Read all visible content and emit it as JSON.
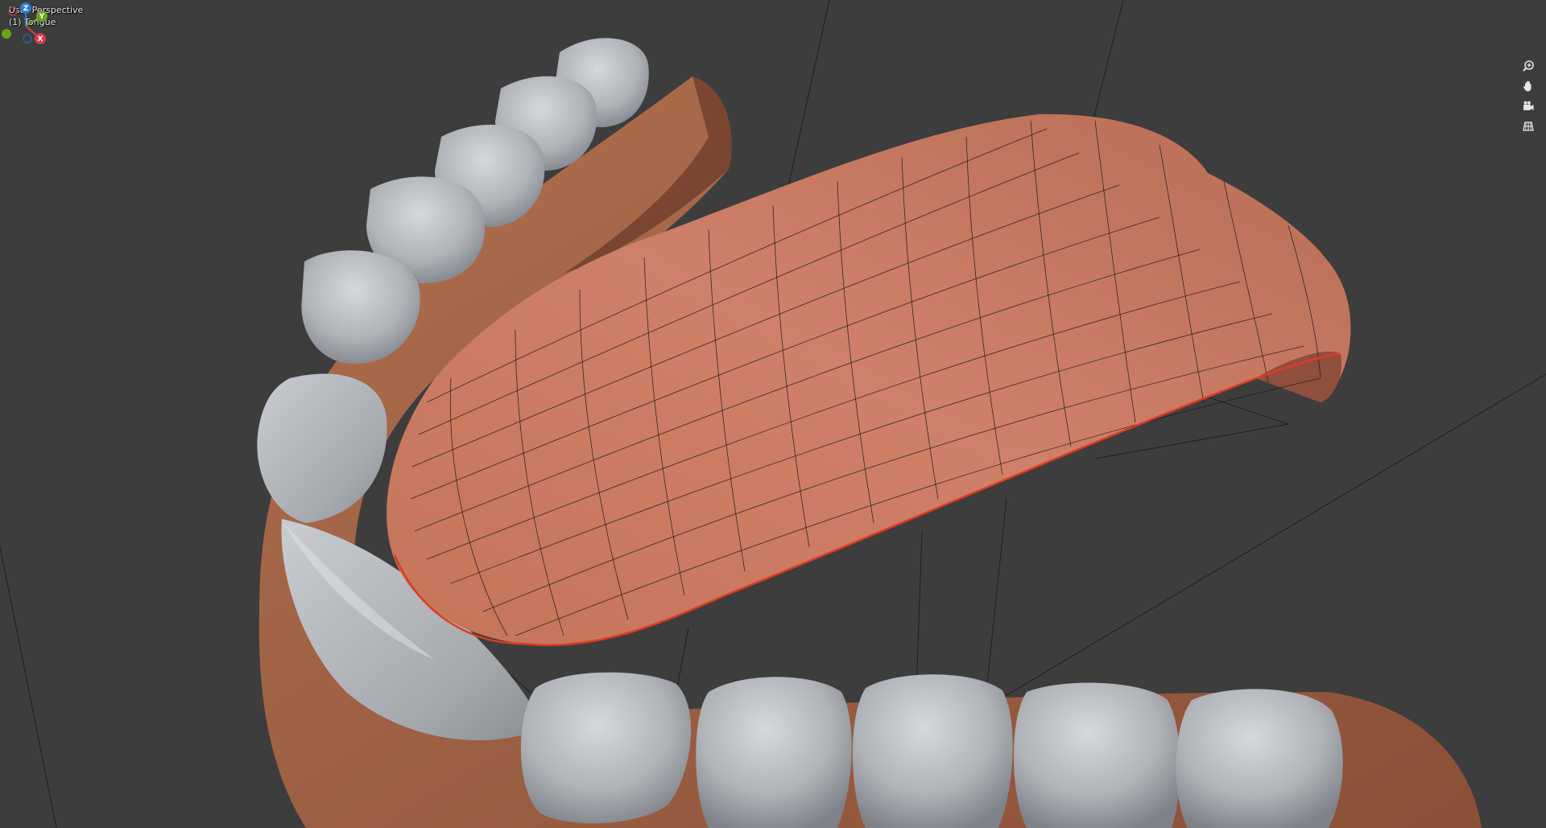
{
  "viewport": {
    "view_label": "User Perspective",
    "object_label": "(1) Tongue"
  },
  "navigation_gizmo": {
    "axes": [
      {
        "name": "Z",
        "color": "#2f7bd6"
      },
      {
        "name": "Y",
        "color": "#6ba31f"
      },
      {
        "name": "X",
        "color": "#d83a4e"
      }
    ]
  },
  "nav_buttons": [
    {
      "id": "zoom",
      "icon": "zoom-icon"
    },
    {
      "id": "pan",
      "icon": "hand-icon"
    },
    {
      "id": "camera",
      "icon": "camera-icon"
    },
    {
      "id": "ortho",
      "icon": "grid-icon"
    }
  ],
  "colors": {
    "background": "#3d3d3d",
    "tongue": "#c87a62",
    "gum": "#a5654a",
    "tooth": "#b3b6bb",
    "wire": "#111111",
    "edge_highlight": "#e03a22"
  }
}
